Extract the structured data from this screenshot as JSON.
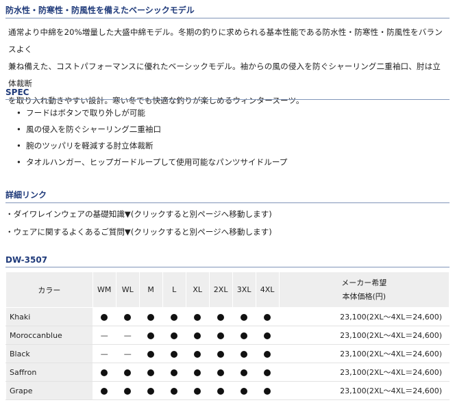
{
  "sections": {
    "headline": "防水性・防寒性・防風性を備えたベーシックモデル",
    "intro_lines": [
      "通常より中綿を20%増量した大盛中綿モデル。冬期の釣りに求められる基本性能である防水性・防寒性・防風性をバランスよく",
      "兼ね備えた、コストパフォーマンスに優れたベーシックモデル。袖からの風の侵入を防ぐシャーリング二重袖口、肘は立体裁断",
      "を取り入れ動きやすい設計。寒い冬でも快適な釣りが楽しめるウィンタースーツ。"
    ],
    "spec_heading": "SPEC",
    "spec_items": [
      "フードはボタンで取り外しが可能",
      "風の侵入を防ぐシャーリング二重袖口",
      "腕のツッパリを軽減する肘立体裁断",
      "タオルハンガー、ヒップガードループして使用可能なパンツサイドループ"
    ],
    "links_heading": "詳細リンク",
    "links": [
      "・ダイワレインウェアの基礎知識▼(クリックすると別ページへ移動します)",
      "・ウェアに関するよくあるご質問▼(クリックすると別ページへ移動します)"
    ],
    "model_heading": "DW-3507"
  },
  "table": {
    "header_color": "カラー",
    "sizes": [
      "WM",
      "WL",
      "M",
      "L",
      "XL",
      "2XL",
      "3XL",
      "4XL"
    ],
    "price_header_line1": "メーカー希望",
    "price_header_line2": "本体価格(円)",
    "available_mark": "●",
    "unavailable_mark": "—",
    "rows": [
      {
        "color": "Khaki",
        "marks": [
          "●",
          "●",
          "●",
          "●",
          "●",
          "●",
          "●",
          "●"
        ],
        "price": "23,100(2XL～4XL＝24,600)"
      },
      {
        "color": "Moroccanblue",
        "marks": [
          "—",
          "—",
          "●",
          "●",
          "●",
          "●",
          "●",
          "●"
        ],
        "price": "23,100(2XL～4XL＝24,600)"
      },
      {
        "color": "Black",
        "marks": [
          "—",
          "—",
          "●",
          "●",
          "●",
          "●",
          "●",
          "●"
        ],
        "price": "23,100(2XL～4XL＝24,600)"
      },
      {
        "color": "Saffron",
        "marks": [
          "●",
          "●",
          "●",
          "●",
          "●",
          "●",
          "●",
          "●"
        ],
        "price": "23,100(2XL～4XL＝24,600)"
      },
      {
        "color": "Grape",
        "marks": [
          "●",
          "●",
          "●",
          "●",
          "●",
          "●",
          "●",
          "●"
        ],
        "price": "23,100(2XL～4XL＝24,600)"
      }
    ]
  }
}
